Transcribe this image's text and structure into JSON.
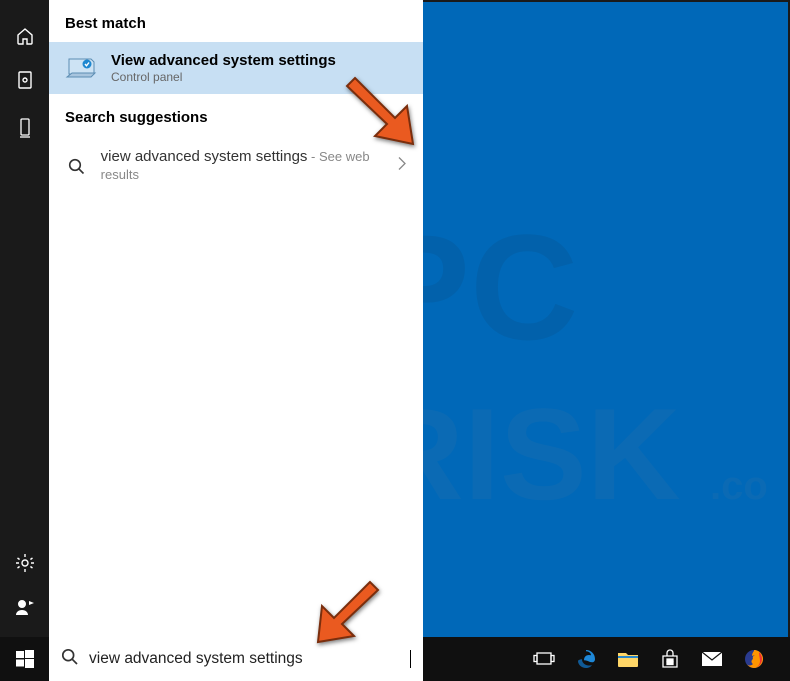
{
  "headings": {
    "best_match": "Best match",
    "suggestions": "Search suggestions"
  },
  "best_match": {
    "title": "View advanced system settings",
    "subtitle": "Control panel"
  },
  "suggestion": {
    "query": "view advanced system settings",
    "tail": " - See web results"
  },
  "search": {
    "value": "view advanced system settings"
  },
  "colors": {
    "highlight": "#c7dff3",
    "taskbar": "#101010",
    "desktop": "#0068b8",
    "arrow": "#ea5a20"
  }
}
